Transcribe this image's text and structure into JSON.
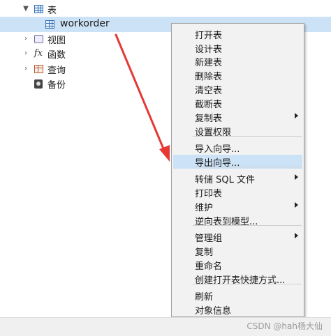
{
  "tree": {
    "tables_label": "表",
    "workorder_label": "workorder",
    "views_label": "视图",
    "functions_label": "函数",
    "queries_label": "查询",
    "backups_label": "备份",
    "fx_glyph": "fx"
  },
  "context_menu": {
    "items": [
      {
        "label": "打开表",
        "submenu": false
      },
      {
        "label": "设计表",
        "submenu": false
      },
      {
        "label": "新建表",
        "submenu": false
      },
      {
        "label": "删除表",
        "submenu": false
      },
      {
        "label": "清空表",
        "submenu": false
      },
      {
        "label": "截断表",
        "submenu": false
      },
      {
        "label": "复制表",
        "submenu": true
      },
      {
        "label": "设置权限",
        "submenu": false
      },
      {
        "label": "导入向导...",
        "submenu": false
      },
      {
        "label": "导出向导...",
        "submenu": false,
        "highlighted": true
      },
      {
        "label": "转储 SQL 文件",
        "submenu": true
      },
      {
        "label": "打印表",
        "submenu": false
      },
      {
        "label": "维护",
        "submenu": true
      },
      {
        "label": "逆向表到模型...",
        "submenu": false
      },
      {
        "label": "管理组",
        "submenu": true
      },
      {
        "label": "复制",
        "submenu": false
      },
      {
        "label": "重命名",
        "submenu": false
      },
      {
        "label": "创建打开表快捷方式...",
        "submenu": false
      },
      {
        "label": "刷新",
        "submenu": false
      },
      {
        "label": "对象信息",
        "submenu": false
      }
    ]
  },
  "watermark": "CSDN @hah杨大仙",
  "colors": {
    "selection": "#cce3f7",
    "annotation_arrow": "#e53935",
    "menu_background": "#f2f2f2"
  }
}
